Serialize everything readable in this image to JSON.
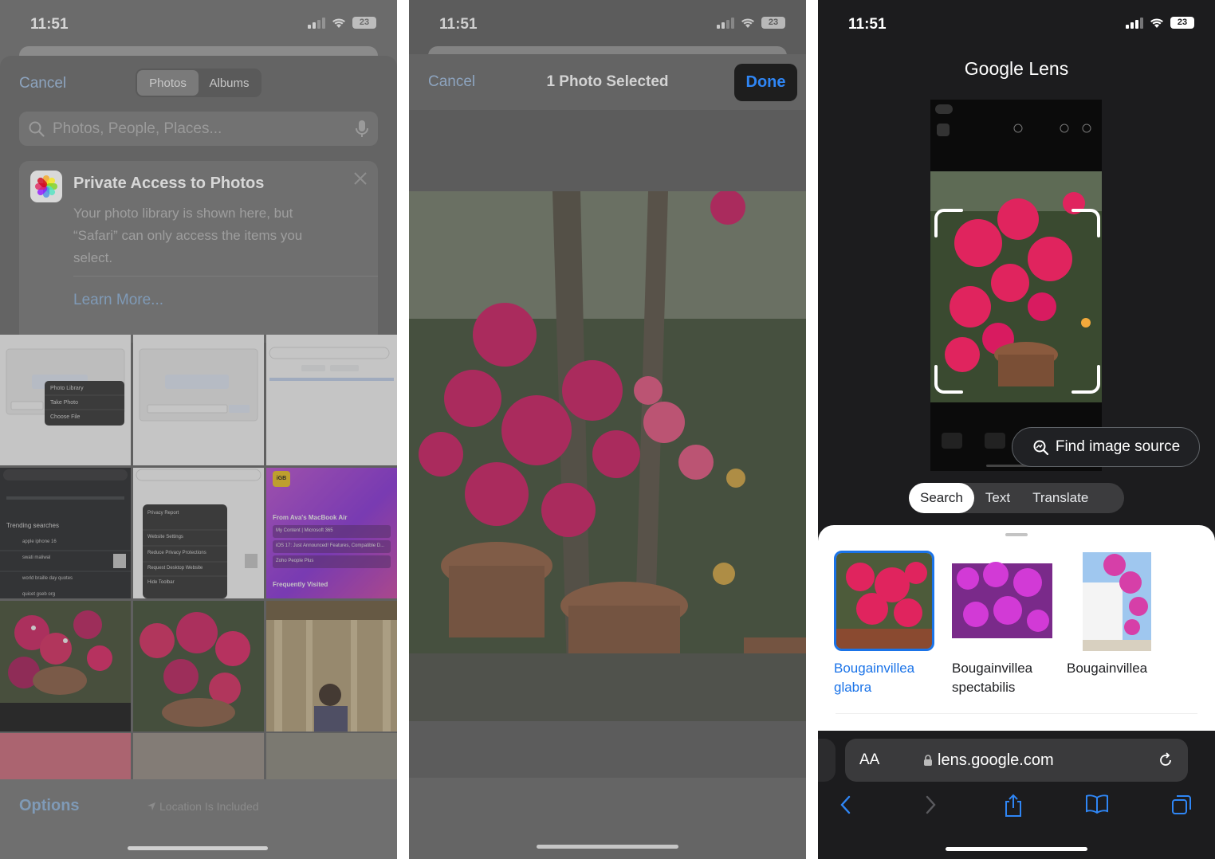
{
  "status": {
    "time": "11:51",
    "battery": "23"
  },
  "picker": {
    "cancel": "Cancel",
    "segments": [
      "Photos",
      "Albums"
    ],
    "search_placeholder": "Photos, People, Places...",
    "card": {
      "title": "Private Access to Photos",
      "body": "Your photo library is shown here, but “Safari” can only access the items you select.",
      "link": "Learn More..."
    },
    "thumb_menu": [
      "Photo Library",
      "Take Photo",
      "Choose File"
    ],
    "dark_thumb": {
      "trending": "Trending searches",
      "items": [
        "apple iphone 16",
        "swati maliwal",
        "world braille day quotes",
        "quicet gseb org"
      ]
    },
    "privacy_menu": [
      "Privacy Report",
      "Website Settings",
      "Reduce Privacy Protections",
      "Request Desktop Website",
      "Hide Toolbar"
    ],
    "igb": {
      "badge": "iGB",
      "heading": "From Ava's MacBook Air",
      "rows": [
        "My Content | Microsoft 365",
        "iOS 17: Just Announced! Features, Compatible D...",
        "Zoho People Plus"
      ],
      "footer": "Frequently Visited"
    },
    "options": "Options",
    "location": "Location Is Included"
  },
  "selection": {
    "cancel": "Cancel",
    "title": "1 Photo Selected",
    "done": "Done"
  },
  "lens": {
    "title": "Google Lens",
    "find_source": "Find image source",
    "tabs": [
      "Search",
      "Text",
      "Translate"
    ],
    "results": [
      {
        "label": "Bougainvillea glabra",
        "selected": true
      },
      {
        "label": "Bougainvillea spectabilis",
        "selected": false
      },
      {
        "label": "Bougainvillea",
        "selected": false
      }
    ],
    "address_aa": "AA",
    "url": "lens.google.com",
    "colors": {
      "accent": "#1a73e8",
      "ios_blue": "#2f86f5",
      "flower": "#e0245e"
    }
  }
}
